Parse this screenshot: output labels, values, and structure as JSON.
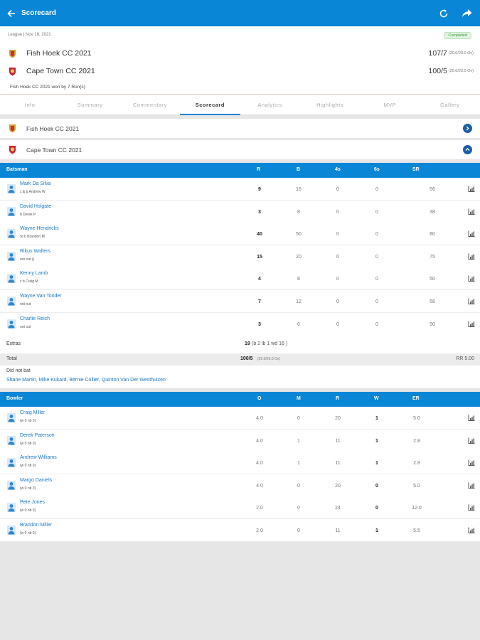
{
  "header": {
    "title": "Scorecard",
    "back_icon": "arrow-left-icon",
    "refresh_icon": "refresh-icon",
    "share_icon": "share-icon"
  },
  "match": {
    "meta": "League | Nov 18, 2021",
    "status": "Completed",
    "team1": {
      "name": "Fish Hoek CC 2021",
      "score": "107/7",
      "overs": "(20.0/20.0 Ov)"
    },
    "team2": {
      "name": "Cape Town CC 2021",
      "score": "100/5",
      "overs": "(20.0/20.0 Ov)"
    },
    "result": "Fish Hoek CC 2021 won by 7 Run(s)"
  },
  "tabs": [
    "Info",
    "Summary",
    "Commentary",
    "Scorecard",
    "Analytics",
    "Highlights",
    "MVP",
    "Gallery"
  ],
  "active_tab": "Scorecard",
  "innings": [
    {
      "name": "Fish Hoek CC 2021",
      "expanded": false
    },
    {
      "name": "Cape Town CC 2021",
      "expanded": true
    }
  ],
  "batting": {
    "headers": {
      "player": "Batsman",
      "r": "R",
      "b": "B",
      "fours": "4s",
      "sixes": "6s",
      "sr": "SR"
    },
    "rows": [
      {
        "name": "Mark Da Silva",
        "dismissal": "c & b Andrew W",
        "r": "9",
        "b": "16",
        "fours": "0",
        "sixes": "0",
        "sr": "56"
      },
      {
        "name": "David Holgate",
        "dismissal": "b Derek P",
        "r": "3",
        "b": "8",
        "fours": "0",
        "sixes": "0",
        "sr": "38"
      },
      {
        "name": "Wayne Hendricks",
        "dismissal": "St b Brandon M",
        "r": "40",
        "b": "50",
        "fours": "0",
        "sixes": "0",
        "sr": "80"
      },
      {
        "name": "Rikus Walters",
        "dismissal": "run out ()",
        "r": "15",
        "b": "20",
        "fours": "0",
        "sixes": "0",
        "sr": "75"
      },
      {
        "name": "Kenny Lamb",
        "dismissal": "c b Craig M",
        "r": "4",
        "b": "8",
        "fours": "0",
        "sixes": "0",
        "sr": "50"
      },
      {
        "name": "Wayne Van Tonder",
        "dismissal": "not out",
        "r": "7",
        "b": "12",
        "fours": "0",
        "sixes": "0",
        "sr": "58"
      },
      {
        "name": "Charlie Reich",
        "dismissal": "not out",
        "r": "3",
        "b": "6",
        "fours": "0",
        "sixes": "0",
        "sr": "50"
      }
    ],
    "extras_label": "Extras",
    "extras_value": "19",
    "extras_detail": "(b 2 lb 1 wd 16 )",
    "total_label": "Total",
    "total_value": "100/5",
    "total_overs": "(20.0/20.0 Ov)",
    "run_rate": "RR 5.00",
    "dnb_label": "Did not bat",
    "dnb_players": "Shane Martin, Mike Kukard, Bernie Collier, Quinton Van Der Westhuizen"
  },
  "bowling": {
    "headers": {
      "player": "Bowler",
      "o": "O",
      "m": "M",
      "r": "R",
      "w": "W",
      "er": "ER"
    },
    "rows": [
      {
        "name": "Craig Miller",
        "extras": "(w 0 nb 0)",
        "o": "4.0",
        "m": "0",
        "r": "20",
        "w": "1",
        "er": "5.0"
      },
      {
        "name": "Derek Paterson",
        "extras": "(w 0 nb 0)",
        "o": "4.0",
        "m": "1",
        "r": "11",
        "w": "1",
        "er": "2.8"
      },
      {
        "name": "Andrew Williams",
        "extras": "(w 0 nb 0)",
        "o": "4.0",
        "m": "1",
        "r": "11",
        "w": "1",
        "er": "2.8"
      },
      {
        "name": "Margo Daniels",
        "extras": "(w 0 nb 0)",
        "o": "4.0",
        "m": "0",
        "r": "20",
        "w": "0",
        "er": "5.0"
      },
      {
        "name": "Pete Jones",
        "extras": "(w 0 nb 0)",
        "o": "2.0",
        "m": "0",
        "r": "24",
        "w": "0",
        "er": "12.0"
      },
      {
        "name": "Brandon Miller",
        "extras": "(w 0 nb 0)",
        "o": "2.0",
        "m": "0",
        "r": "11",
        "w": "1",
        "er": "5.5"
      }
    ]
  },
  "colors": {
    "accent": "#0a86d6",
    "link": "#1a78c8",
    "toggle": "#1b5ea8",
    "status_green": "#3a9a3a"
  },
  "icons": {
    "avatar": "person-avatar-icon",
    "graph": "bar-chart-icon",
    "logo": "club-crest-icon"
  }
}
